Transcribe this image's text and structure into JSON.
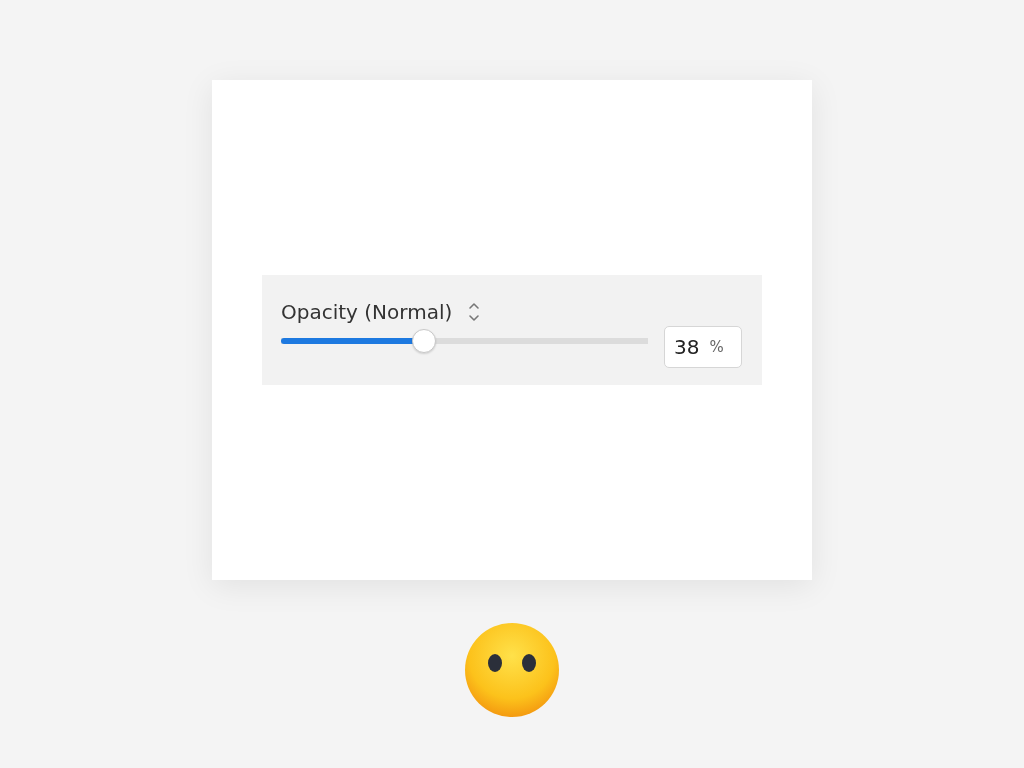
{
  "opacity_control": {
    "label": "Opacity (Normal)",
    "level": 0.39,
    "value": "38",
    "unit": "%"
  }
}
